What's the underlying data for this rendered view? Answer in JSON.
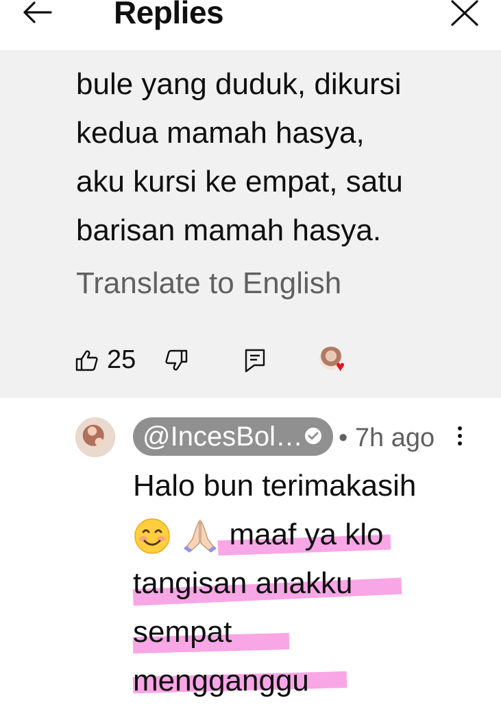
{
  "header": {
    "title": "Replies"
  },
  "parent_comment": {
    "text_lines": [
      "bule yang duduk, dikursi",
      "kedua mamah hasya,",
      "aku kursi ke empat, satu",
      "barisan mamah hasya."
    ],
    "translate_label": "Translate to English",
    "like_count": "25",
    "creator_heart": true
  },
  "reply": {
    "author": "@IncesBol…",
    "verified": true,
    "separator": "•",
    "time_ago": "7h ago",
    "text_lines": [
      "Halo bun terimakasih",
      "maaf ya klo",
      "tangisan anakku",
      "sempat",
      "mengganggu"
    ],
    "emoji": [
      "smiling-face-with-smiling-eyes",
      "folded-hands"
    ],
    "highlight_color": "#f470d6"
  }
}
